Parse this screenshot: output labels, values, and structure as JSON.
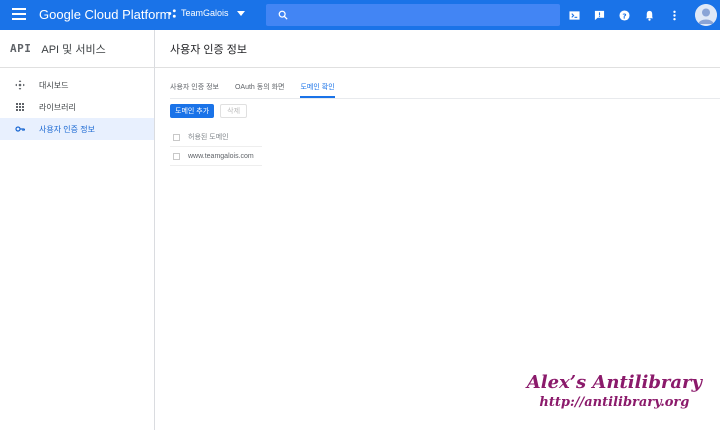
{
  "header": {
    "app_title": "Google Cloud Platform",
    "project_name": "TeamGalois",
    "search_placeholder": "",
    "icons": [
      "menu-icon",
      "terminal-icon",
      "notification-alert-icon",
      "help-icon",
      "bell-icon",
      "more-vert-icon",
      "account-avatar"
    ]
  },
  "sidebar": {
    "logo": "API",
    "title": "API 및 서비스",
    "items": [
      {
        "label": "대시보드",
        "icon": "dashboard-icon",
        "active": false
      },
      {
        "label": "라이브러리",
        "icon": "library-icon",
        "active": false
      },
      {
        "label": "사용자 인증 정보",
        "icon": "key-icon",
        "active": true
      }
    ]
  },
  "main": {
    "page_title": "사용자 인증 정보",
    "tabs": [
      {
        "label": "사용자 인증 정보",
        "active": false
      },
      {
        "label": "OAuth 동의 화면",
        "active": false
      },
      {
        "label": "도메인 확인",
        "active": true
      }
    ],
    "add_domain_button": "도메인 추가",
    "delete_button": "삭제",
    "table": {
      "header": "허용된 도메인",
      "rows": [
        "www.teamgalois.com"
      ]
    }
  },
  "watermark": {
    "title": "Alex’s Antilibrary",
    "url": "http://antilibrary.org"
  },
  "colors": {
    "accent": "#1a73e8",
    "topbar": "#1a73e8",
    "active_nav_bg": "#e8f0fe",
    "watermark": "#8b1a6b"
  }
}
